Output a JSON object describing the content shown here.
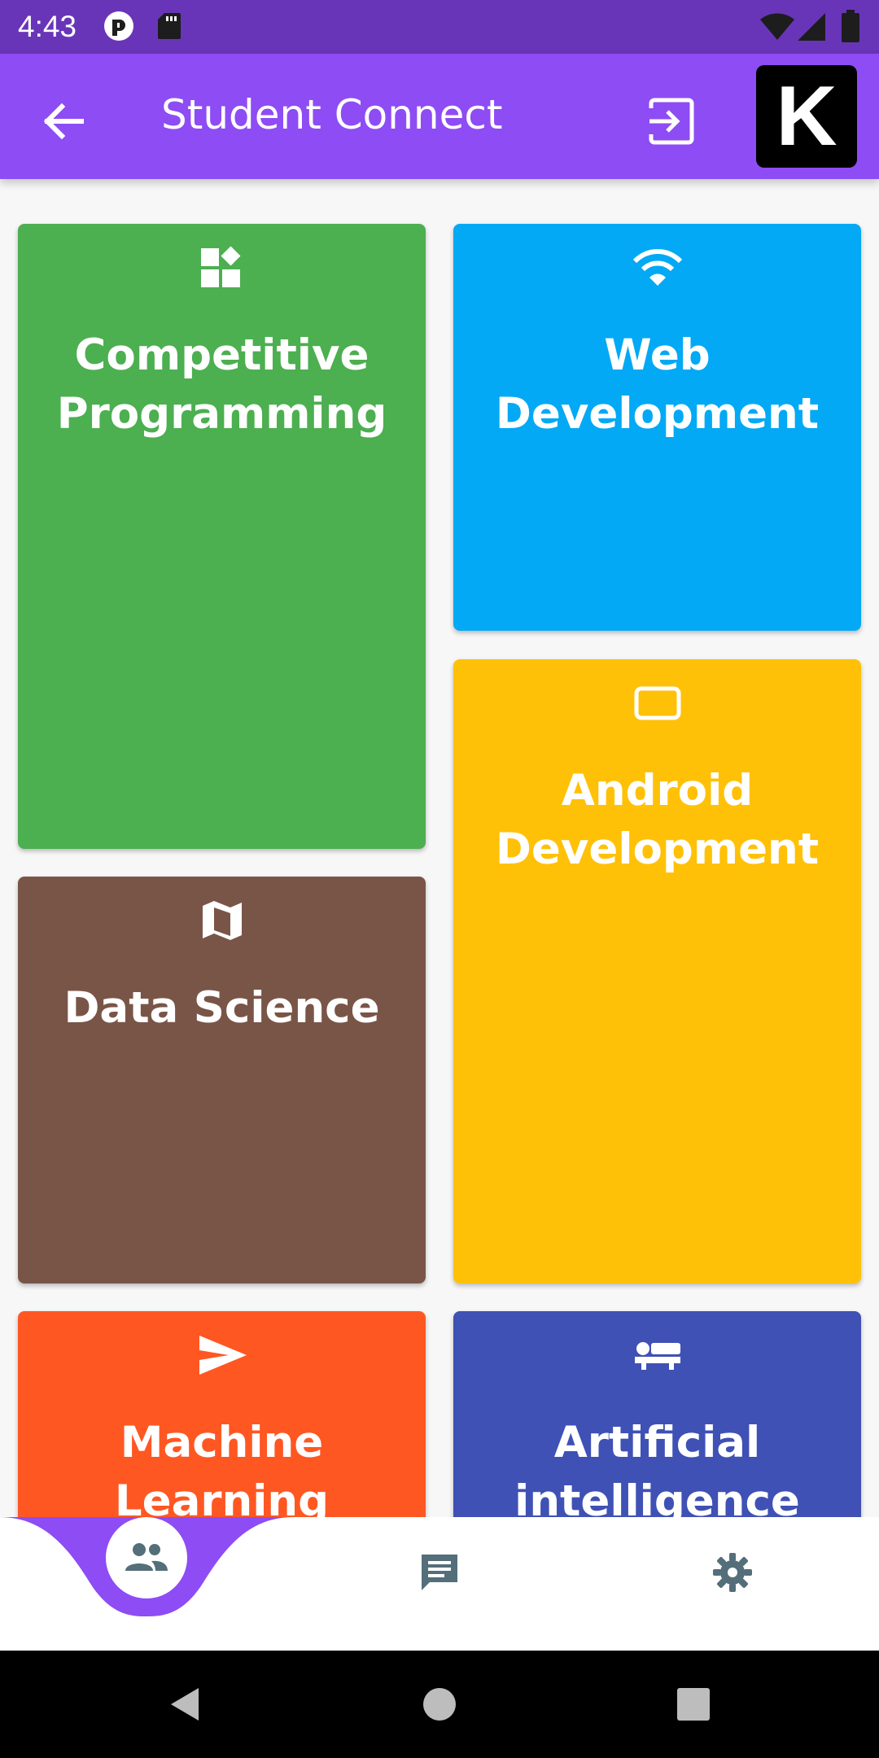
{
  "status_bar": {
    "time": "4:43",
    "icons": [
      "notification-app-icon",
      "sd-card-icon",
      "wifi-icon",
      "cell-signal-icon",
      "battery-icon"
    ]
  },
  "app_bar": {
    "title": "Student Connect",
    "avatar_letter": "K",
    "color": "#8e4cf4"
  },
  "categories": [
    {
      "title": "Competitive\nProgramming",
      "icon": "dashboard-widgets-icon",
      "color": "#4caf50"
    },
    {
      "title": "Web\nDevelopment",
      "icon": "wifi-icon",
      "color": "#03a9f4"
    },
    {
      "title": "Android\nDevelopment",
      "icon": "tablet-icon",
      "color": "#ffc107"
    },
    {
      "title": "Data Science",
      "icon": "map-icon",
      "color": "#795548"
    },
    {
      "title": "Machine\nLearning",
      "icon": "send-icon",
      "color": "#ff5722"
    },
    {
      "title": "Artificial\nintelligence",
      "icon": "hotel-bed-icon",
      "color": "#3f51b5"
    }
  ],
  "bottom_nav": {
    "items": [
      {
        "name": "people-icon",
        "active": true
      },
      {
        "name": "chat-icon",
        "active": false
      },
      {
        "name": "settings-icon",
        "active": false
      }
    ],
    "active_color": "#8e4cf4",
    "icon_color": "#546e7a"
  },
  "system_nav": {
    "buttons": [
      "back-triangle-icon",
      "home-circle-icon",
      "recents-square-icon"
    ]
  }
}
